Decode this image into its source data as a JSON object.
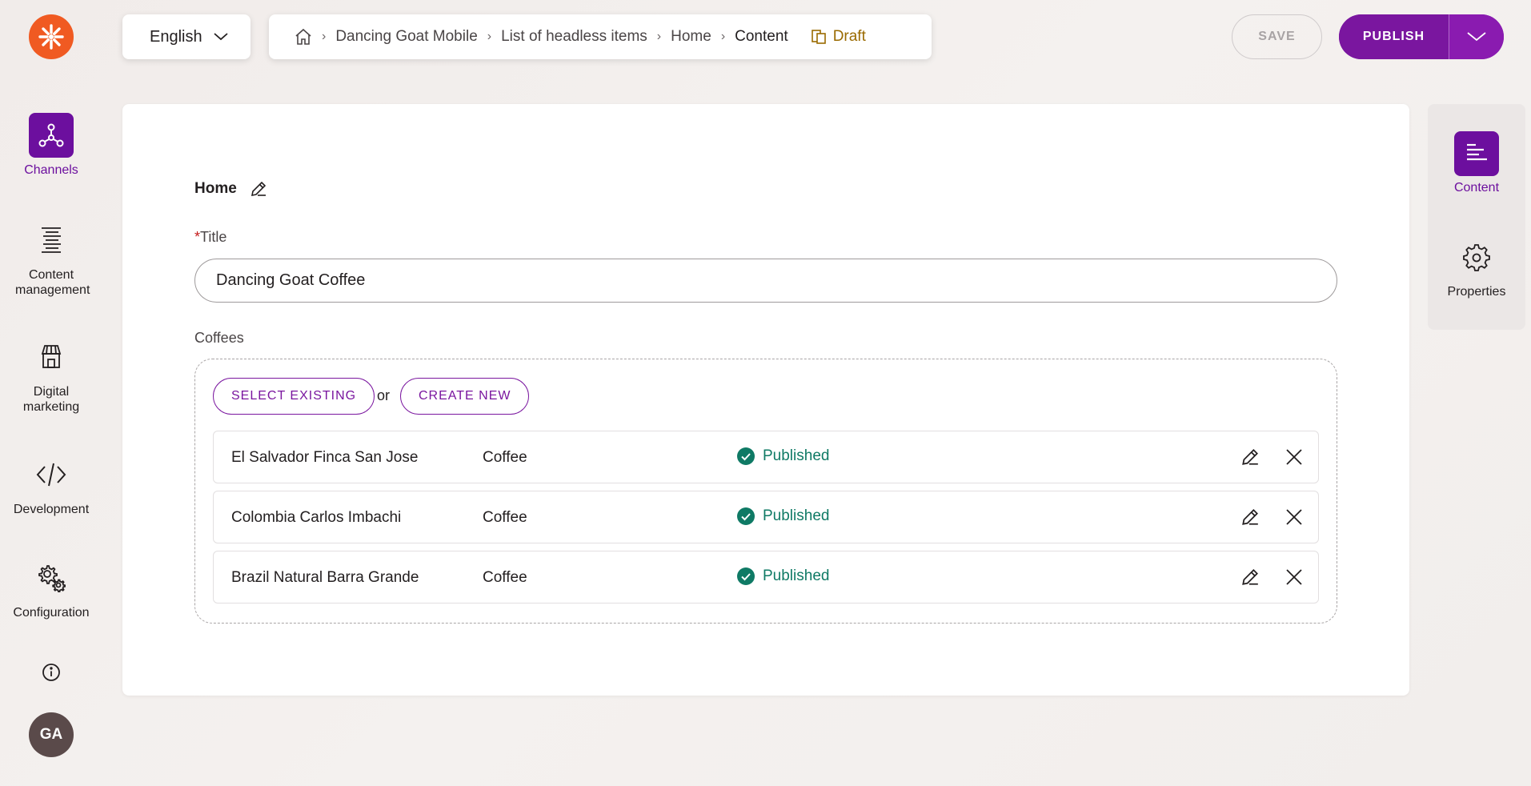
{
  "nav": {
    "items": [
      {
        "id": "channels",
        "label": "Channels",
        "icon": "channels-icon",
        "active": true
      },
      {
        "id": "content-management",
        "label": "Content management",
        "icon": "content-management-icon",
        "active": false
      },
      {
        "id": "digital-marketing",
        "label": "Digital marketing",
        "icon": "digital-marketing-icon",
        "active": false
      },
      {
        "id": "development",
        "label": "Development",
        "icon": "code-icon",
        "active": false
      },
      {
        "id": "configuration",
        "label": "Configuration",
        "icon": "gears-icon",
        "active": false
      }
    ],
    "avatar_initials": "GA"
  },
  "language": {
    "selected": "English"
  },
  "breadcrumb": {
    "items": [
      "Dancing Goat Mobile",
      "List of headless items",
      "Home"
    ],
    "current": "Content",
    "status": "Draft"
  },
  "actions": {
    "save_label": "SAVE",
    "publish_label": "PUBLISH"
  },
  "form": {
    "section_title": "Home",
    "title_required_mark": "*",
    "title_label": "Title",
    "title_value": "Dancing Goat Coffee",
    "coffees_label": "Coffees",
    "select_existing_label": "SELECT EXISTING",
    "or_text": "or",
    "create_new_label": "CREATE NEW",
    "items": [
      {
        "name": "El Salvador Finca San Jose",
        "type": "Coffee",
        "status": "Published"
      },
      {
        "name": "Colombia Carlos Imbachi",
        "type": "Coffee",
        "status": "Published"
      },
      {
        "name": "Brazil Natural Barra Grande",
        "type": "Coffee",
        "status": "Published"
      }
    ]
  },
  "right_panel": {
    "content_label": "Content",
    "properties_label": "Properties"
  },
  "colors": {
    "brand_purple": "#7a169f",
    "logo_orange": "#f05a22",
    "published_green": "#0f7a65",
    "draft_gold": "#9a6a00"
  }
}
